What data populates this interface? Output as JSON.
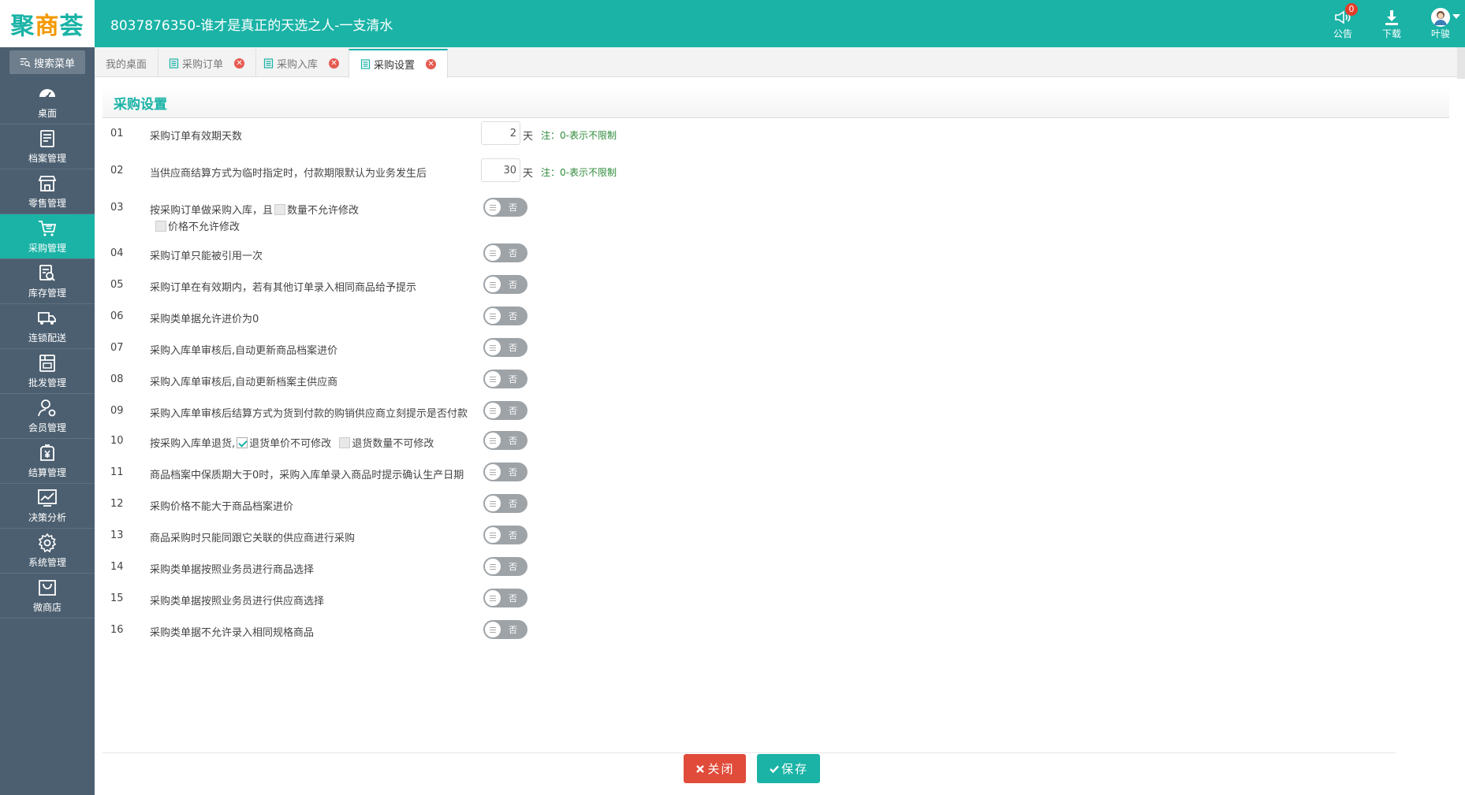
{
  "app": {
    "logo_text": "聚商荟",
    "window_title": "8037876350-谁才是真正的天选之人-一支清水"
  },
  "topbar": {
    "notice_label": "公告",
    "notice_badge": "0",
    "download_label": "下载",
    "user_label": "叶骏"
  },
  "sidebar": {
    "search_label": "搜索菜单",
    "items": [
      {
        "label": "桌面",
        "icon": "dashboard-icon"
      },
      {
        "label": "档案管理",
        "icon": "archive-icon"
      },
      {
        "label": "零售管理",
        "icon": "store-icon"
      },
      {
        "label": "采购管理",
        "icon": "cart-icon"
      },
      {
        "label": "库存管理",
        "icon": "inventory-search-icon"
      },
      {
        "label": "连锁配送",
        "icon": "truck-icon"
      },
      {
        "label": "批发管理",
        "icon": "wholesale-icon"
      },
      {
        "label": "会员管理",
        "icon": "member-icon"
      },
      {
        "label": "结算管理",
        "icon": "yen-icon"
      },
      {
        "label": "决策分析",
        "icon": "chart-icon"
      },
      {
        "label": "系统管理",
        "icon": "gear-icon"
      },
      {
        "label": "微商店",
        "icon": "bag-icon"
      }
    ],
    "active_index": 3
  },
  "tabs": [
    {
      "label": "我的桌面",
      "closable": false
    },
    {
      "label": "采购订单",
      "closable": true
    },
    {
      "label": "采购入库",
      "closable": true
    },
    {
      "label": "采购设置",
      "closable": true,
      "active": true
    }
  ],
  "panel": {
    "title": "采购设置"
  },
  "settings": {
    "toggle_off_label": "否",
    "rows": [
      {
        "num": "01",
        "text": "采购订单有效期天数",
        "value": "2",
        "unit": "天",
        "note": "注：0-表示不限制"
      },
      {
        "num": "02",
        "text": "当供应商结算方式为临时指定时，付款期限默认为业务发生后",
        "value": "30",
        "unit": "天",
        "note": "注：0-表示不限制"
      },
      {
        "num": "03",
        "text_a": "按采购订单做采购入库，且",
        "cb1_label": "数量不允许修改",
        "cb2_label": "价格不允许修改"
      },
      {
        "num": "04",
        "text": "采购订单只能被引用一次"
      },
      {
        "num": "05",
        "text": "采购订单在有效期内，若有其他订单录入相同商品给予提示"
      },
      {
        "num": "06",
        "text": "采购类单据允许进价为0"
      },
      {
        "num": "07",
        "text": "采购入库单审核后,自动更新商品档案进价"
      },
      {
        "num": "08",
        "text": "采购入库单审核后,自动更新档案主供应商"
      },
      {
        "num": "09",
        "text": "采购入库单审核后结算方式为货到付款的购销供应商立刻提示是否付款"
      },
      {
        "num": "10",
        "text_a": "按采购入库单退货,",
        "cb1_label": "退货单价不可修改",
        "cb2_label": "退货数量不可修改"
      },
      {
        "num": "11",
        "text": "商品档案中保质期大于0时，采购入库单录入商品时提示确认生产日期"
      },
      {
        "num": "12",
        "text": "采购价格不能大于商品档案进价"
      },
      {
        "num": "13",
        "text": "商品采购时只能同跟它关联的供应商进行采购"
      },
      {
        "num": "14",
        "text": "采购类单据按照业务员进行商品选择"
      },
      {
        "num": "15",
        "text": "采购类单据按照业务员进行供应商选择"
      },
      {
        "num": "16",
        "text": "采购类单据不允许录入相同规格商品"
      }
    ]
  },
  "footer": {
    "close_label": "关闭",
    "save_label": "保存"
  }
}
